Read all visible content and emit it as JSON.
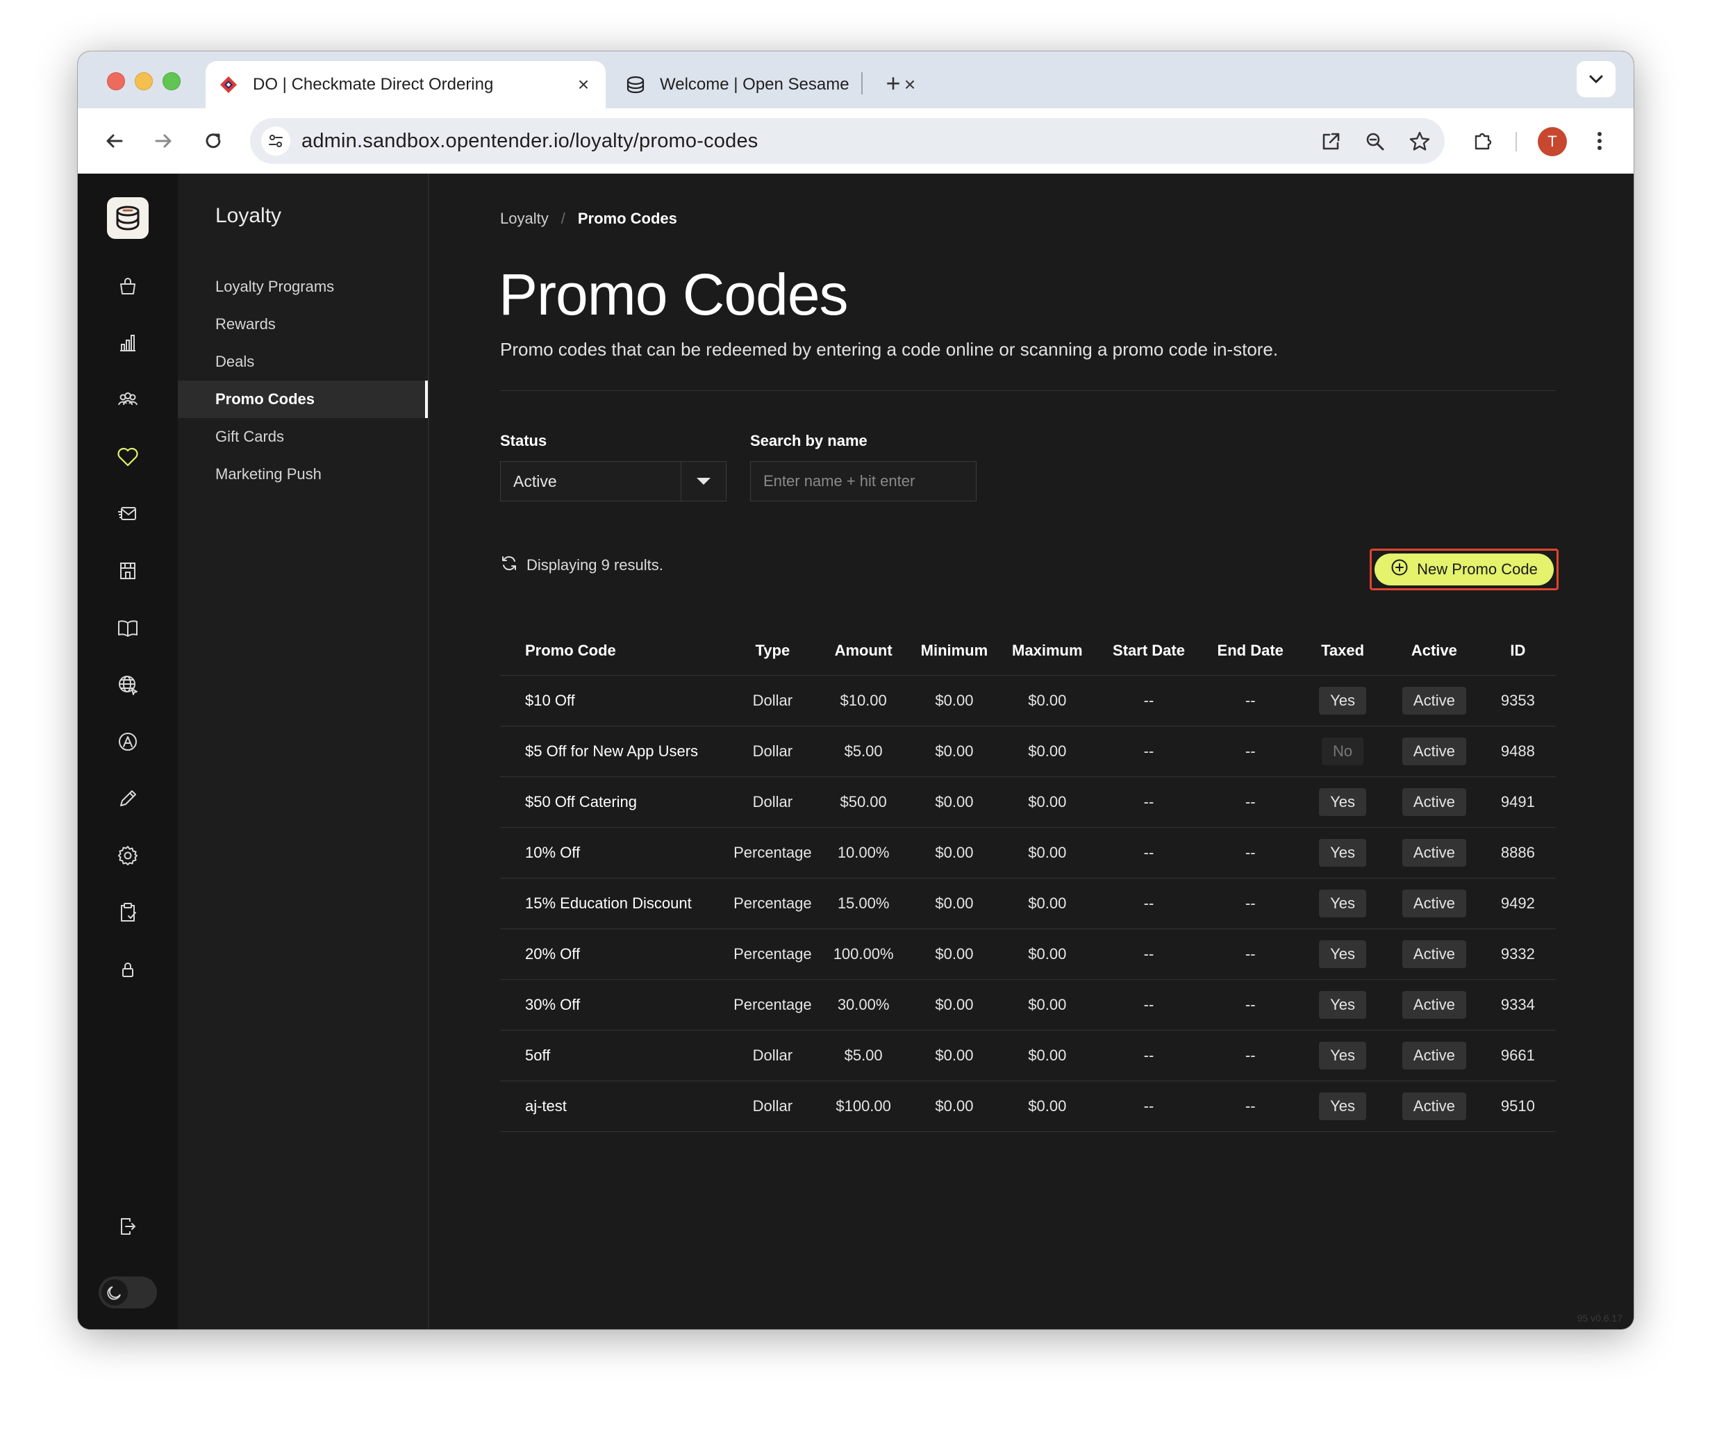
{
  "browser": {
    "tabs": [
      {
        "title": "DO | Checkmate Direct Ordering",
        "active": true
      },
      {
        "title": "Welcome | Open Sesame",
        "active": false
      }
    ],
    "url": "admin.sandbox.opentender.io/loyalty/promo-codes",
    "profile_initial": "T"
  },
  "rail": {
    "icons": [
      "shopping-bag-icon",
      "bar-chart-icon",
      "users-icon",
      "heart-icon",
      "mail-icon",
      "store-icon",
      "book-icon",
      "globe-icon",
      "app-store-icon",
      "pencil-icon",
      "gear-icon",
      "clipboard-check-icon",
      "lock-icon",
      "logout-icon"
    ],
    "active_icon": "heart-icon",
    "accent": "#e4f26c"
  },
  "subnav": {
    "title": "Loyalty",
    "items": [
      {
        "label": "Loyalty Programs"
      },
      {
        "label": "Rewards"
      },
      {
        "label": "Deals"
      },
      {
        "label": "Promo Codes",
        "active": true
      },
      {
        "label": "Gift Cards"
      },
      {
        "label": "Marketing Push"
      }
    ]
  },
  "breadcrumb": {
    "parent": "Loyalty",
    "separator": "/",
    "current": "Promo Codes"
  },
  "page": {
    "title": "Promo Codes",
    "subtitle": "Promo codes that can be redeemed by entering a code online or scanning a promo code in-store."
  },
  "filters": {
    "status_label": "Status",
    "status_value": "Active",
    "search_label": "Search by name",
    "search_placeholder": "Enter name + hit enter",
    "search_value": ""
  },
  "results_text": "Displaying 9 results.",
  "new_button_label": "New Promo Code",
  "table": {
    "columns": [
      "Promo Code",
      "Type",
      "Amount",
      "Minimum",
      "Maximum",
      "Start Date",
      "End Date",
      "Taxed",
      "Active",
      "ID"
    ],
    "rows": [
      {
        "name": "$10 Off",
        "type": "Dollar",
        "amount": "$10.00",
        "minimum": "$0.00",
        "maximum": "$0.00",
        "start": "--",
        "end": "--",
        "taxed": "Yes",
        "active": "Active",
        "id": "9353"
      },
      {
        "name": "$5 Off for New App Users",
        "type": "Dollar",
        "amount": "$5.00",
        "minimum": "$0.00",
        "maximum": "$0.00",
        "start": "--",
        "end": "--",
        "taxed": "No",
        "active": "Active",
        "id": "9488"
      },
      {
        "name": "$50 Off Catering",
        "type": "Dollar",
        "amount": "$50.00",
        "minimum": "$0.00",
        "maximum": "$0.00",
        "start": "--",
        "end": "--",
        "taxed": "Yes",
        "active": "Active",
        "id": "9491"
      },
      {
        "name": "10% Off",
        "type": "Percentage",
        "amount": "10.00%",
        "minimum": "$0.00",
        "maximum": "$0.00",
        "start": "--",
        "end": "--",
        "taxed": "Yes",
        "active": "Active",
        "id": "8886"
      },
      {
        "name": "15% Education Discount",
        "type": "Percentage",
        "amount": "15.00%",
        "minimum": "$0.00",
        "maximum": "$0.00",
        "start": "--",
        "end": "--",
        "taxed": "Yes",
        "active": "Active",
        "id": "9492"
      },
      {
        "name": "20% Off",
        "type": "Percentage",
        "amount": "100.00%",
        "minimum": "$0.00",
        "maximum": "$0.00",
        "start": "--",
        "end": "--",
        "taxed": "Yes",
        "active": "Active",
        "id": "9332"
      },
      {
        "name": "30% Off",
        "type": "Percentage",
        "amount": "30.00%",
        "minimum": "$0.00",
        "maximum": "$0.00",
        "start": "--",
        "end": "--",
        "taxed": "Yes",
        "active": "Active",
        "id": "9334"
      },
      {
        "name": "5off",
        "type": "Dollar",
        "amount": "$5.00",
        "minimum": "$0.00",
        "maximum": "$0.00",
        "start": "--",
        "end": "--",
        "taxed": "Yes",
        "active": "Active",
        "id": "9661"
      },
      {
        "name": "aj-test",
        "type": "Dollar",
        "amount": "$100.00",
        "minimum": "$0.00",
        "maximum": "$0.00",
        "start": "--",
        "end": "--",
        "taxed": "Yes",
        "active": "Active",
        "id": "9510"
      }
    ]
  },
  "version": "95   v0.6.17"
}
